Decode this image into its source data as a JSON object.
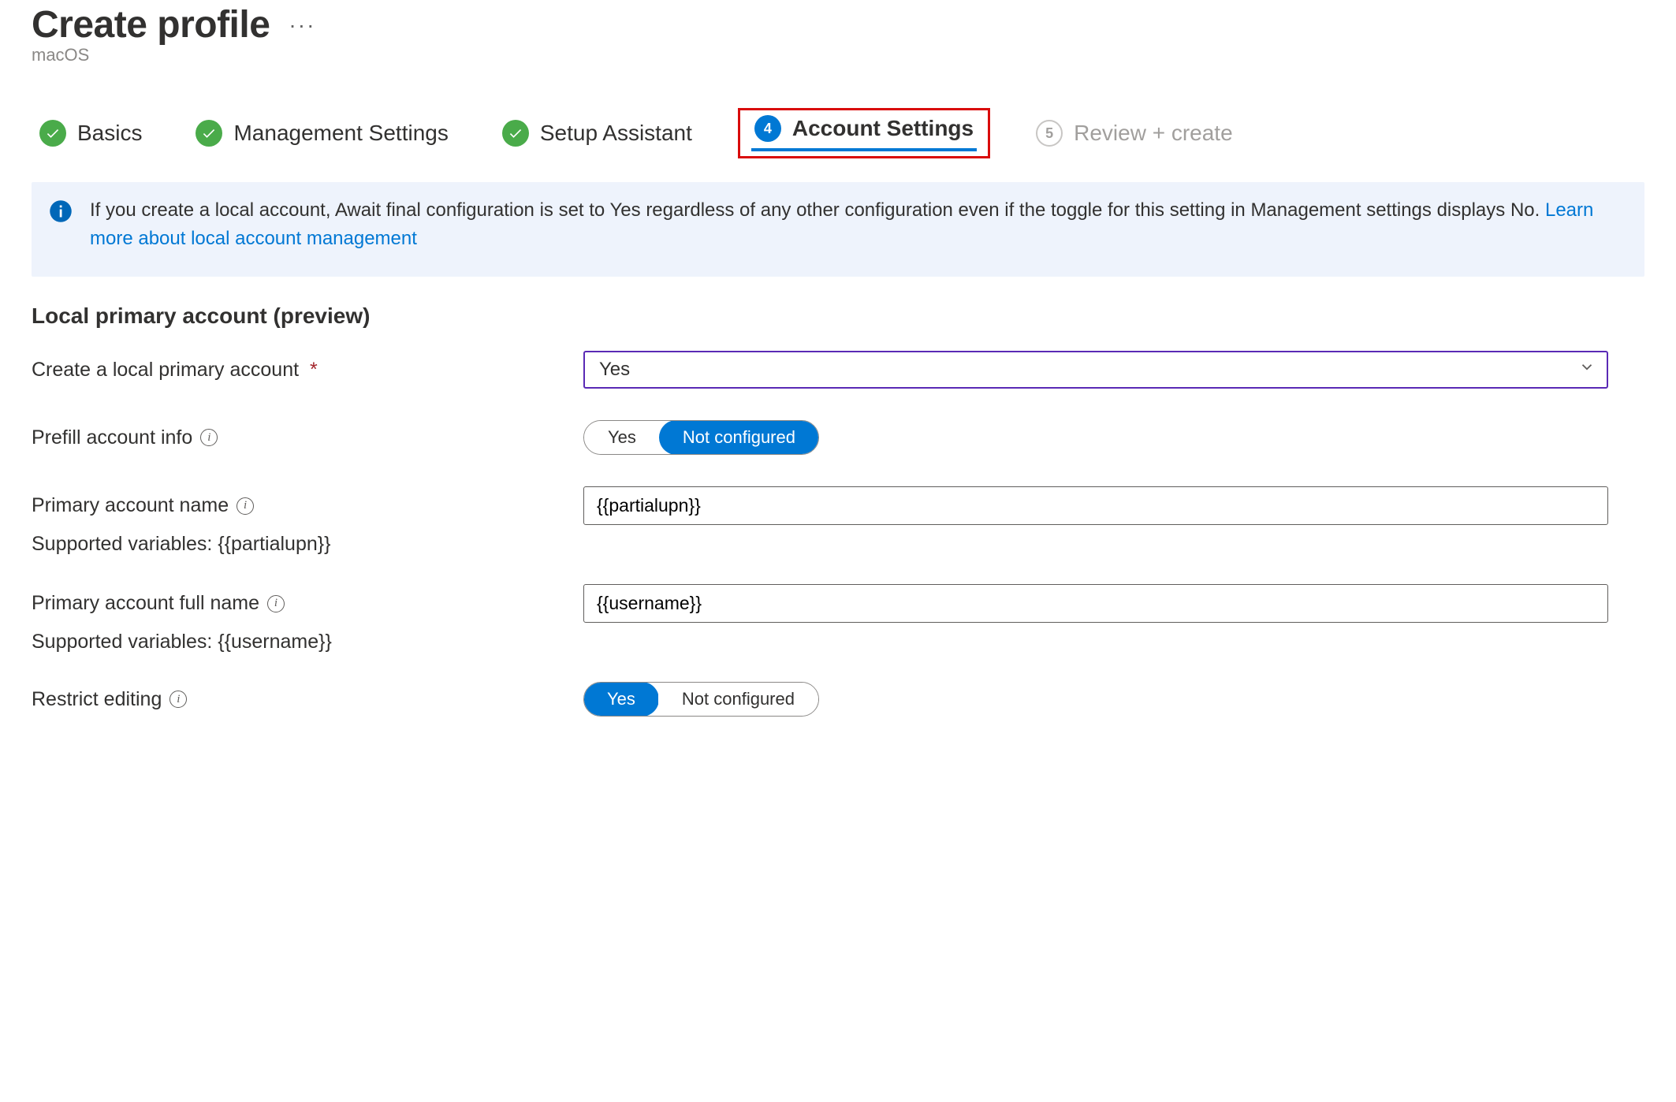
{
  "header": {
    "title": "Create profile",
    "subtitle": "macOS",
    "overflow": "···"
  },
  "stepper": {
    "steps": [
      {
        "num": "1",
        "label": "Basics",
        "state": "done"
      },
      {
        "num": "2",
        "label": "Management Settings",
        "state": "done"
      },
      {
        "num": "3",
        "label": "Setup Assistant",
        "state": "done"
      },
      {
        "num": "4",
        "label": "Account Settings",
        "state": "current"
      },
      {
        "num": "5",
        "label": "Review + create",
        "state": "future"
      }
    ]
  },
  "info": {
    "text_before_link": "If you create a local account, Await final configuration is set to Yes regardless of any other configuration even if the toggle for this setting in Management settings displays No. ",
    "link_text": "Learn more about local account management"
  },
  "section": {
    "heading": "Local primary account (preview)"
  },
  "form": {
    "create_local": {
      "label": "Create a local primary account",
      "value": "Yes"
    },
    "prefill": {
      "label": "Prefill account info",
      "opt_yes": "Yes",
      "opt_no": "Not configured",
      "selected": "Not configured"
    },
    "primary_name": {
      "label": "Primary account name",
      "value": "{{partialupn}}",
      "hint": "Supported variables: {{partialupn}}"
    },
    "primary_full_name": {
      "label": "Primary account full name",
      "value": "{{username}}",
      "hint": "Supported variables: {{username}}"
    },
    "restrict": {
      "label": "Restrict editing",
      "opt_yes": "Yes",
      "opt_no": "Not configured",
      "selected": "Yes"
    }
  }
}
